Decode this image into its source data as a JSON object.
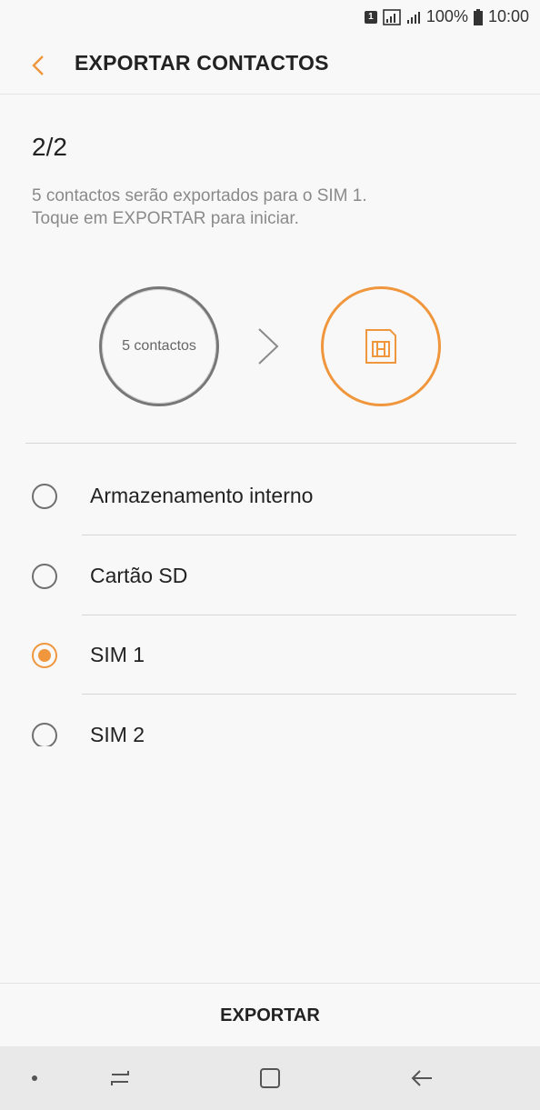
{
  "status_bar": {
    "sim_indicator": "1",
    "battery": "100%",
    "time": "10:00",
    "icons": [
      "sim-slot-icon",
      "signal-icon",
      "signal-bars-icon",
      "battery-icon"
    ]
  },
  "app_bar": {
    "title": "EXPORTAR CONTACTOS",
    "back_icon": "chevron-left-icon"
  },
  "step": "2/2",
  "description_line1": "5 contactos serão exportados para o SIM 1.",
  "description_line2": "Toque em EXPORTAR para iniciar.",
  "illustration": {
    "source_label": "5 contactos",
    "arrow_icon": "chevron-right-icon",
    "target_icon": "sim-card-icon",
    "accent_color": "#f0963d"
  },
  "options": [
    {
      "label": "Armazenamento interno",
      "selected": false
    },
    {
      "label": "Cartão SD",
      "selected": false
    },
    {
      "label": "SIM 1",
      "selected": true
    },
    {
      "label": "SIM 2",
      "selected": false
    }
  ],
  "export_button": "EXPORTAR",
  "nav": [
    "nav-dot-icon",
    "recent-apps-icon",
    "home-icon",
    "back-arrow-icon"
  ]
}
